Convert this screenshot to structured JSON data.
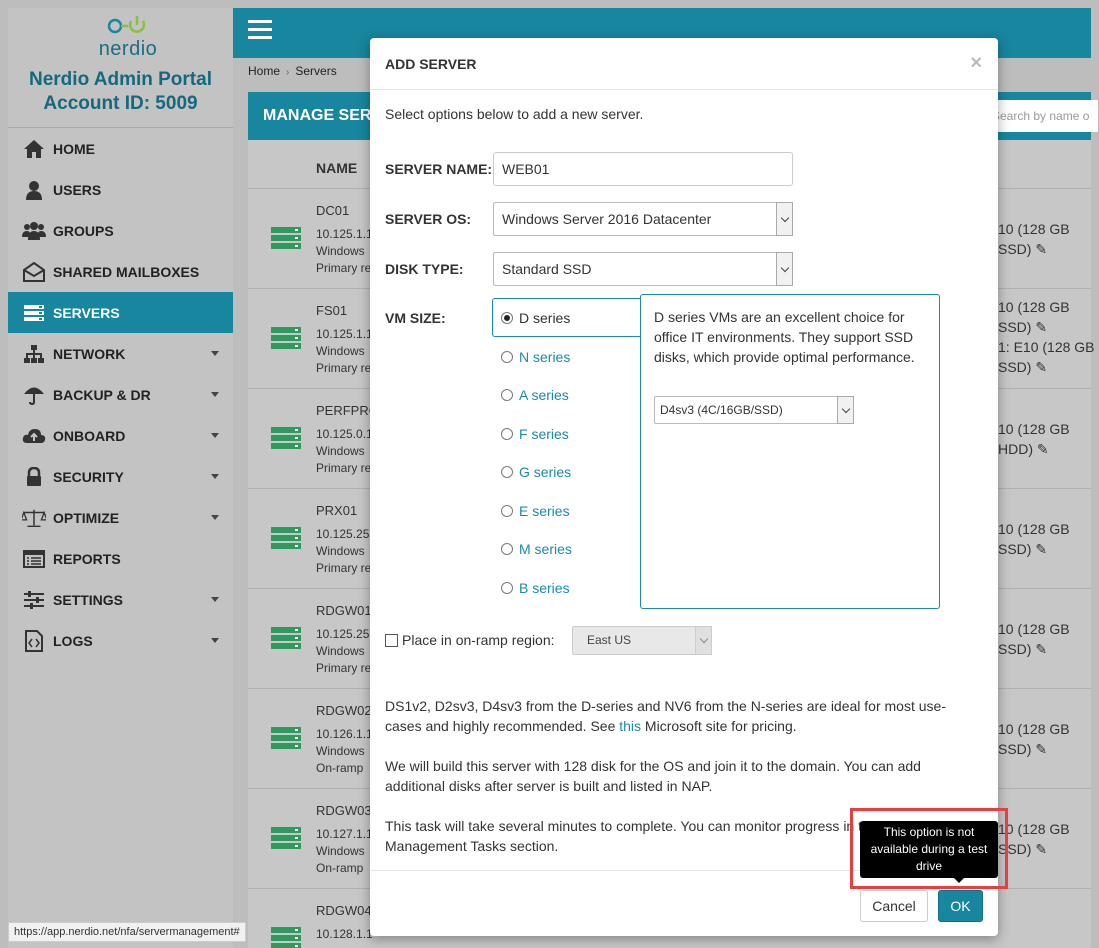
{
  "sidebar": {
    "logo_text": "nerdio",
    "portal_title": "Nerdio Admin Portal",
    "account_id": "Account ID: 5009",
    "items": [
      {
        "label": "HOME",
        "icon": "home-icon"
      },
      {
        "label": "USERS",
        "icon": "user-icon"
      },
      {
        "label": "GROUPS",
        "icon": "users-icon"
      },
      {
        "label": "SHARED MAILBOXES",
        "icon": "envelope-open-icon"
      },
      {
        "label": "SERVERS",
        "icon": "server-icon",
        "active": true
      },
      {
        "label": "NETWORK",
        "icon": "sitemap-icon",
        "expandable": true
      },
      {
        "label": "BACKUP & DR",
        "icon": "umbrella-icon",
        "expandable": true
      },
      {
        "label": "ONBOARD",
        "icon": "cloud-upload-icon",
        "expandable": true
      },
      {
        "label": "SECURITY",
        "icon": "lock-icon",
        "expandable": true
      },
      {
        "label": "OPTIMIZE",
        "icon": "balance-scale-icon",
        "expandable": true
      },
      {
        "label": "REPORTS",
        "icon": "report-list-icon"
      },
      {
        "label": "SETTINGS",
        "icon": "sliders-icon",
        "expandable": true
      },
      {
        "label": "LOGS",
        "icon": "code-file-icon",
        "expandable": true
      }
    ]
  },
  "breadcrumb": {
    "home": "Home",
    "current": "Servers"
  },
  "manage": {
    "title": "MANAGE SERV",
    "search_placeholder": "Search by name o"
  },
  "table": {
    "name_header": "NAME",
    "rows": [
      {
        "name": "DC01",
        "line1": "10.125.1.1",
        "line2": "Windows",
        "line3": "Primary re",
        "right1": "10 (128 GB",
        "right2": "SSD)"
      },
      {
        "name": "FS01",
        "line1": "10.125.1.1",
        "line2": "Windows",
        "line3": "Primary re",
        "right1": "10 (128 GB",
        "right2": "SSD)",
        "right3": "1: E10 (128 GB",
        "right4": "SSD)"
      },
      {
        "name": "PERFPRO",
        "line1": "10.125.0.1",
        "line2": "Windows",
        "line3": "Primary re",
        "right1": "10 (128 GB",
        "right2": "HDD)"
      },
      {
        "name": "PRX01",
        "line1": "10.125.25",
        "line2": "Windows",
        "line3": "Primary re",
        "right1": "10 (128 GB",
        "right2": "SSD)"
      },
      {
        "name": "RDGW01",
        "line1": "10.125.25",
        "line2": "Windows",
        "line3": "Primary re",
        "right1": "10 (128 GB",
        "right2": "SSD)"
      },
      {
        "name": "RDGW02",
        "line1": "10.126.1.1",
        "line2": "Windows",
        "line3": "On-ramp",
        "right1": "10 (128 GB",
        "right2": "SSD)"
      },
      {
        "name": "RDGW03",
        "line1": "10.127.1.1",
        "line2": "Windows",
        "line3": "On-ramp",
        "right1": "10 (128 GB",
        "right2": "SSD)"
      },
      {
        "name": "RDGW04",
        "line1": "10.128.1.1",
        "line2": "",
        "line3": "",
        "right1": "",
        "right2": ""
      }
    ]
  },
  "status_url": "https://app.nerdio.net/nfa/servermanagement#",
  "modal": {
    "title": "ADD SERVER",
    "close": "×",
    "intro": "Select options below to add a new server.",
    "server_name_label": "SERVER NAME:",
    "server_name_value": "WEB01",
    "server_os_label": "SERVER OS:",
    "server_os_value": "Windows Server 2016 Datacenter",
    "disk_type_label": "DISK TYPE:",
    "disk_type_value": "Standard SSD",
    "vm_size_label": "VM SIZE:",
    "series": [
      "D series",
      "N series",
      "A series",
      "F series",
      "G series",
      "E series",
      "M series",
      "B series"
    ],
    "selected_series": "D series",
    "series_description": "D series VMs are an excellent choice for office IT environments. They support SSD disks, which provide optimal performance.",
    "size_value": "D4sv3 (4C/16GB/SSD)",
    "onramp_label": "Place in on-ramp region:",
    "region_value": "East US",
    "info1_a": "DS1v2, D2sv3, D4sv3 from the D-series and NV6 from the N-series are ideal for most use-cases and highly recommended. See ",
    "info1_link": "this",
    "info1_b": " Microsoft site for pricing.",
    "info2": "We will build this server with 128 disk for the OS and join it to the domain. You can add additional disks after server is built and listed in NAP.",
    "info3": "This task will take several minutes to complete. You can monitor progress in the Management Tasks section.",
    "cancel_label": "Cancel",
    "ok_label": "OK",
    "tooltip": "This option is not available during a test drive"
  },
  "colors": {
    "brand": "#17869e",
    "server_icon": "#2e9a5e",
    "highlight": "#e53f3f"
  }
}
